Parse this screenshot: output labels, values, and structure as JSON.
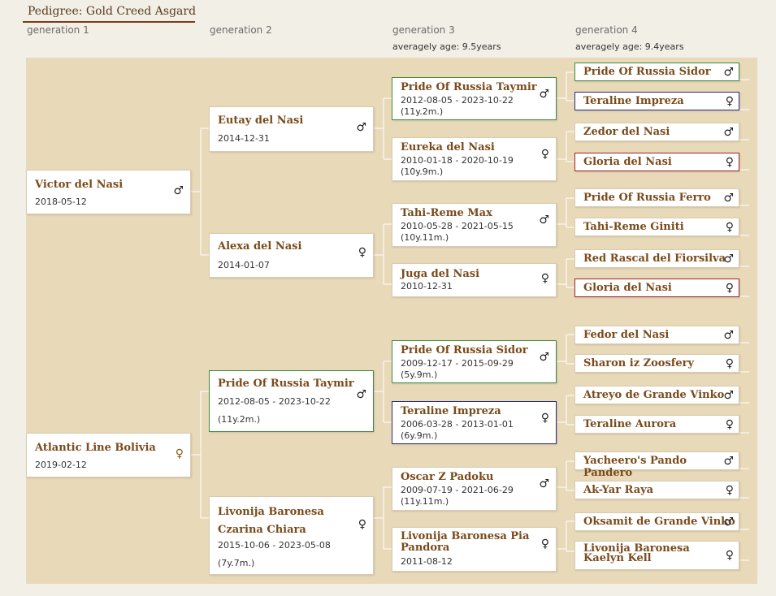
{
  "title": "Pedigree: Gold Creed Asgard",
  "generations": [
    {
      "label": "generation 1",
      "avg": ""
    },
    {
      "label": "generation 2",
      "avg": ""
    },
    {
      "label": "generation 3",
      "avg": "averagely age: 9.5years"
    },
    {
      "label": "generation 4",
      "avg": "averagely age: 9.4years"
    }
  ],
  "sex_symbols": {
    "male": "♂",
    "female": "♀"
  },
  "gen1": [
    {
      "name": "Victor del Nasi",
      "date": "2018-05-12",
      "age": "",
      "sex": "♂"
    },
    {
      "name": "Atlantic Line Bolivia",
      "date": "2019-02-12",
      "age": "",
      "sex": "♀"
    }
  ],
  "gen2": [
    {
      "name": "Eutay del Nasi",
      "date": "2014-12-31",
      "age": "",
      "sex": "♂"
    },
    {
      "name": "Alexa del Nasi",
      "date": "2014-01-07",
      "age": "",
      "sex": "♀"
    },
    {
      "name": "Pride Of Russia Taymir",
      "date": "2012-08-05 - 2023-10-22",
      "age": "(11y.2m.)",
      "sex": "♂"
    },
    {
      "name": "Livonija Baronesa Czarina Chiara",
      "date": "2015-10-06 - 2023-05-08",
      "age": "(7y.7m.)",
      "sex": "♀"
    }
  ],
  "gen3": [
    {
      "name": "Pride Of Russia Taymir",
      "date": "2012-08-05 - 2023-10-22",
      "age": "(11y.2m.)",
      "sex": "♂"
    },
    {
      "name": "Eureka del Nasi",
      "date": "2010-01-18 - 2020-10-19",
      "age": "(10y.9m.)",
      "sex": "♀"
    },
    {
      "name": "Tahi-Reme Max",
      "date": "2010-05-28 - 2021-05-15",
      "age": "(10y.11m.)",
      "sex": "♂"
    },
    {
      "name": "Juga del Nasi",
      "date": "2010-12-31",
      "age": "",
      "sex": "♀"
    },
    {
      "name": "Pride Of Russia Sidor",
      "date": "2009-12-17 - 2015-09-29",
      "age": "(5y.9m.)",
      "sex": "♂"
    },
    {
      "name": "Teraline Impreza",
      "date": "2006-03-28 - 2013-01-01",
      "age": "(6y.9m.)",
      "sex": "♀"
    },
    {
      "name": "Oscar Z Padoku",
      "date": "2009-07-19 - 2021-06-29",
      "age": "(11y.11m.)",
      "sex": "♂"
    },
    {
      "name": "Livonija Baronesa Pia Pandora",
      "date": "2011-08-12",
      "age": "",
      "sex": "♀"
    }
  ],
  "gen4": [
    {
      "name": "Pride Of Russia Sidor",
      "sex": "♂"
    },
    {
      "name": "Teraline Impreza",
      "sex": "♀"
    },
    {
      "name": "Zedor del Nasi",
      "sex": "♂"
    },
    {
      "name": "Gloria del Nasi",
      "sex": "♀"
    },
    {
      "name": "Pride Of Russia Ferro",
      "sex": "♂"
    },
    {
      "name": "Tahi-Reme Giniti",
      "sex": "♀"
    },
    {
      "name": "Red Rascal del Fiorsilva",
      "sex": "♂"
    },
    {
      "name": "Gloria del Nasi",
      "sex": "♀"
    },
    {
      "name": "Fedor del Nasi",
      "sex": "♂"
    },
    {
      "name": "Sharon iz Zoosfery",
      "sex": "♀"
    },
    {
      "name": "Atreyo de Grande Vinko",
      "sex": "♂"
    },
    {
      "name": "Teraline Aurora",
      "sex": "♀"
    },
    {
      "name": "Yacheero's Pando Pandero",
      "sex": "♂"
    },
    {
      "name": "Ak-Yar Raya",
      "sex": "♀"
    },
    {
      "name": "Oksamit de Grande Vinko",
      "sex": "♂"
    },
    {
      "name": "Livonija Baronesa Kaelyn Kell",
      "sex": "♀"
    }
  ]
}
